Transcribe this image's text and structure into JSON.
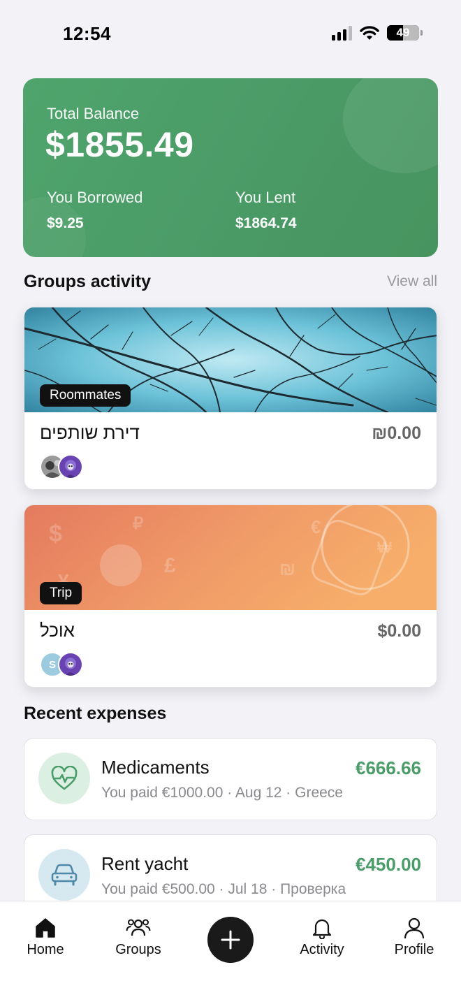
{
  "status_bar": {
    "time": "12:54",
    "battery": "49",
    "battery_level": 0.49
  },
  "balance": {
    "label": "Total Balance",
    "amount": "$1855.49",
    "borrowed_label": "You Borrowed",
    "borrowed_amount": "$9.25",
    "lent_label": "You Lent",
    "lent_amount": "$1864.74",
    "color": "#4fa46c"
  },
  "groups_section": {
    "title": "Groups activity",
    "view_all": "View all"
  },
  "groups": [
    {
      "badge": "Roommates",
      "name": "דירת שותפים",
      "balance": "₪0.00",
      "banner": "branches-photo"
    },
    {
      "badge": "Trip",
      "name": "אוכל",
      "balance": "$0.00",
      "banner": "currency-gradient",
      "avatar_initial": "S"
    }
  ],
  "recent_section": {
    "title": "Recent expenses"
  },
  "expenses": [
    {
      "name": "Medicaments",
      "meta": "You paid €1000.00 · Aug 12 · Greece",
      "amount": "€666.66",
      "icon": "heartbeat-icon",
      "icon_bg": "#dcefe3",
      "icon_color": "#4a9d68"
    },
    {
      "name": "Rent yacht",
      "meta": "You paid €500.00 · Jul 18 · Проверка",
      "amount": "€450.00",
      "icon": "car-icon",
      "icon_bg": "#d6e9f1",
      "icon_color": "#4f88a8"
    }
  ],
  "amount_color": "#4a9d68",
  "tabbar": {
    "home": "Home",
    "groups": "Groups",
    "activity": "Activity",
    "profile": "Profile"
  }
}
